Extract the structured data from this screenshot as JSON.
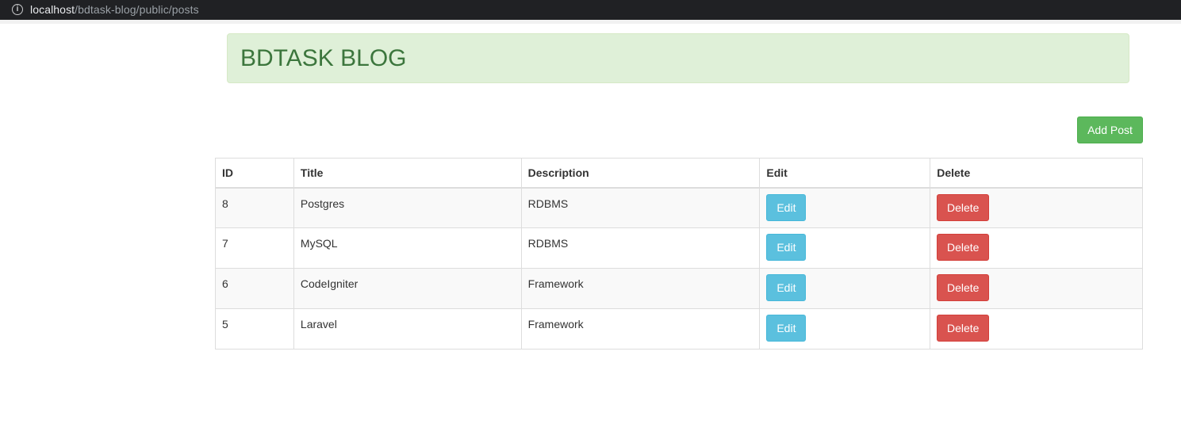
{
  "browser": {
    "url_host": "localhost",
    "url_path": "/bdtask-blog/public/posts"
  },
  "header": {
    "title": "BDTASK BLOG"
  },
  "toolbar": {
    "add_label": "Add Post"
  },
  "table": {
    "columns": [
      "ID",
      "Title",
      "Description",
      "Edit",
      "Delete"
    ],
    "rows": [
      {
        "id": "8",
        "title": "Postgres",
        "description": "RDBMS",
        "edit": "Edit",
        "delete": "Delete"
      },
      {
        "id": "7",
        "title": "MySQL",
        "description": "RDBMS",
        "edit": "Edit",
        "delete": "Delete"
      },
      {
        "id": "6",
        "title": "CodeIgniter",
        "description": "Framework",
        "edit": "Edit",
        "delete": "Delete"
      },
      {
        "id": "5",
        "title": "Laravel",
        "description": "Framework",
        "edit": "Edit",
        "delete": "Delete"
      }
    ]
  },
  "colors": {
    "banner_bg": "#dff0d8",
    "banner_text": "#3c763d",
    "success": "#5cb85c",
    "info": "#5bc0de",
    "danger": "#d9534f"
  }
}
